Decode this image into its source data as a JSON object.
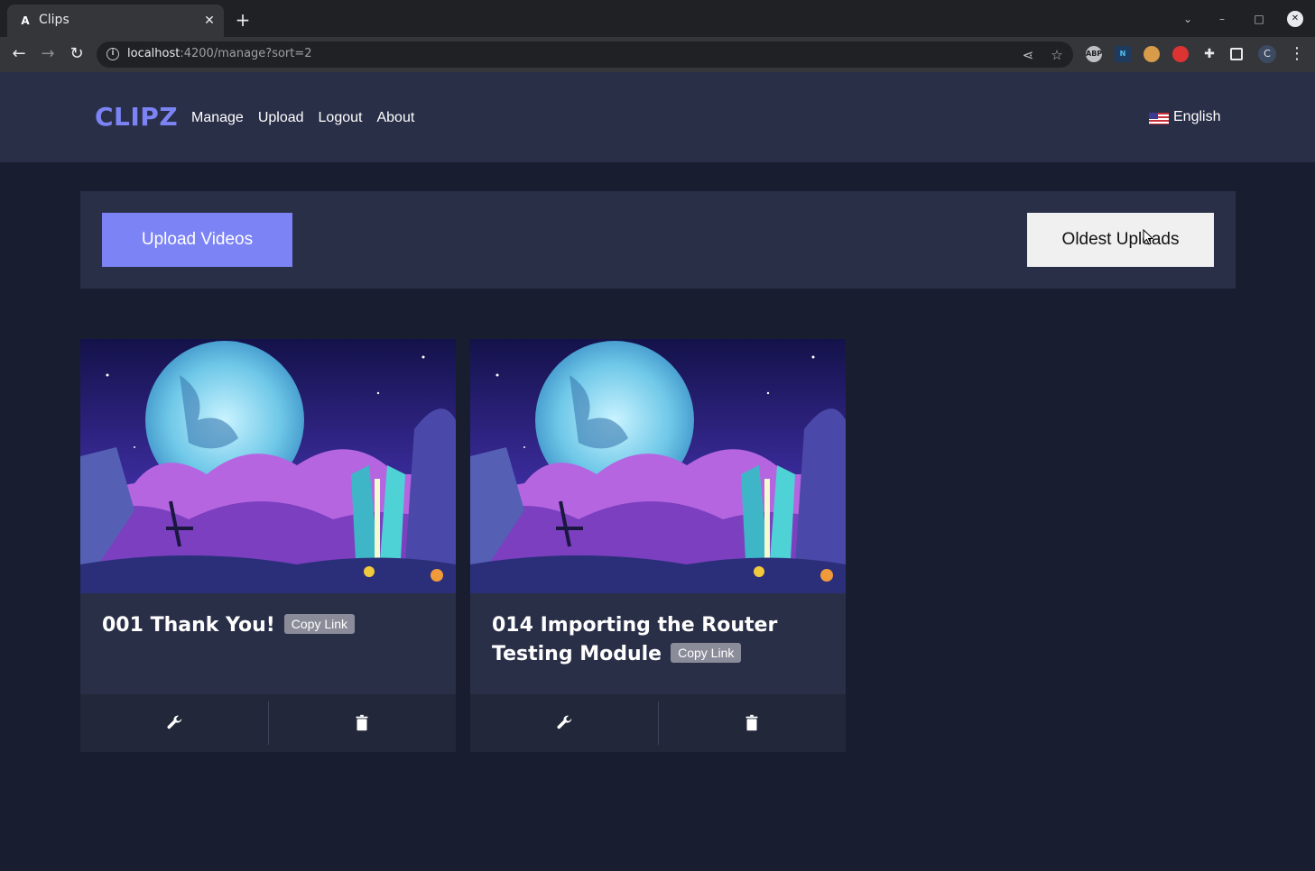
{
  "browser": {
    "tab_title": "Clips",
    "tab_favicon": "A",
    "url_host": "localhost",
    "url_rest": ":4200/manage?sort=2",
    "profile_initial": "C",
    "extensions": [
      "ABP",
      "N"
    ]
  },
  "header": {
    "brand": "CLIPZ",
    "nav": [
      "Manage",
      "Upload",
      "Logout",
      "About"
    ],
    "language": "English"
  },
  "controls": {
    "upload_label": "Upload Videos",
    "sort_label": "Oldest Uploads"
  },
  "clips": [
    {
      "title": "001 Thank You!",
      "copy_label": "Copy Link"
    },
    {
      "title": "014 Importing the Router Testing Module",
      "copy_label": "Copy Link"
    }
  ],
  "colors": {
    "accent": "#7c83f5",
    "page_bg": "#181d2f",
    "panel_bg": "#2a2f48"
  }
}
